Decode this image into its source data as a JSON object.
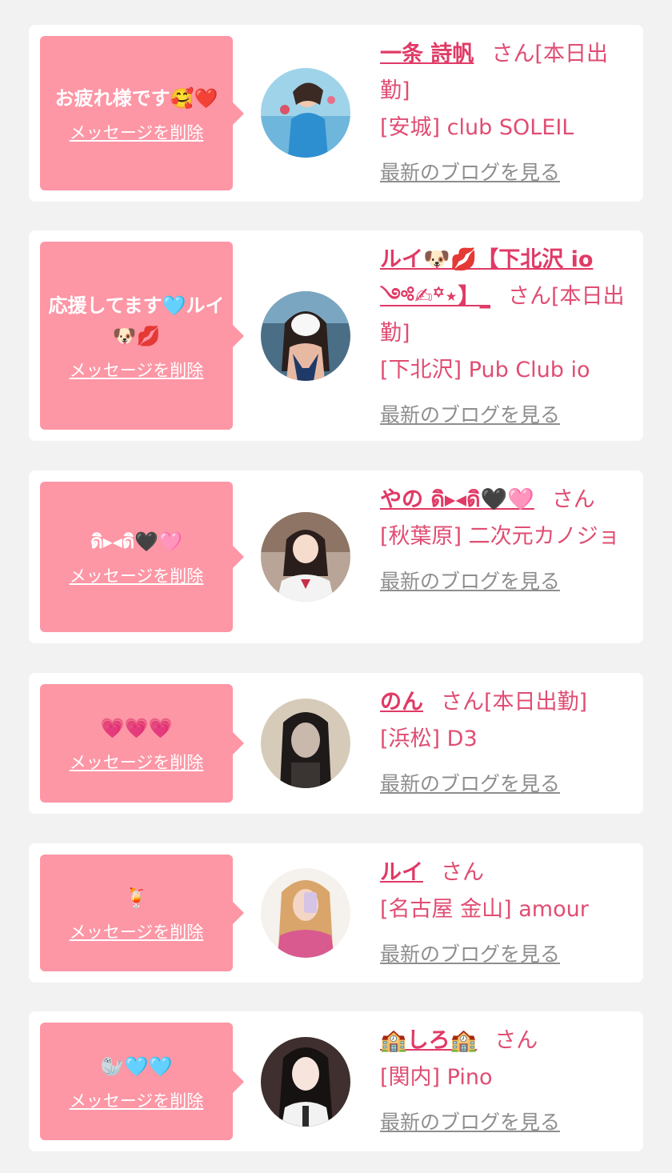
{
  "theme": {
    "card_bg": "#ffffff",
    "bubble_bg": "#fd96a5",
    "name_color": "#e03a66",
    "text_color": "#e04d72",
    "link_gray": "#8e8e8e",
    "page_bg": "#f2f2f2"
  },
  "items": [
    {
      "message": "お疲れ様です🥰❤️",
      "delete_label": "メッセージを削除",
      "name": "一条 詩帆",
      "suffix": "さん[本日出勤]",
      "shop": "[安城] club SOLEIL",
      "blog_label": "最新のブログを見る",
      "avatar_icon": "avatar-photo"
    },
    {
      "message": "応援してます🩵ルイ🐶💋",
      "delete_label": "メッセージを削除",
      "name": "ルイ🐶💋【下北沢 io ༺✍︎꙳⋆】_",
      "suffix": "さん[本日出勤]",
      "shop": "[下北沢] Pub Club io",
      "blog_label": "最新のブログを見る",
      "avatar_icon": "avatar-photo"
    },
    {
      "message": "ดิ▸◂ดิ🖤🩷",
      "delete_label": "メッセージを削除",
      "name": "やの ดิ▸◂ดิ🖤🩷",
      "suffix": "さん",
      "shop": "[秋葉原] 二次元カノジョ",
      "blog_label": "最新のブログを見る",
      "avatar_icon": "avatar-photo"
    },
    {
      "message": "💗💗💗",
      "delete_label": "メッセージを削除",
      "name": "のん",
      "suffix": "さん[本日出勤]",
      "shop": "[浜松] D3",
      "blog_label": "最新のブログを見る",
      "avatar_icon": "avatar-photo"
    },
    {
      "message": "🍹",
      "delete_label": "メッセージを削除",
      "name": "ルイ",
      "suffix": "さん",
      "shop": "[名古屋 金山] amour",
      "blog_label": "最新のブログを見る",
      "avatar_icon": "avatar-photo"
    },
    {
      "message": "🦭🩵🩵",
      "delete_label": "メッセージを削除",
      "name": "🏫しろ🏫",
      "suffix": "さん",
      "shop": "[関内] Pino",
      "blog_label": "最新のブログを見る",
      "avatar_icon": "avatar-photo"
    }
  ]
}
